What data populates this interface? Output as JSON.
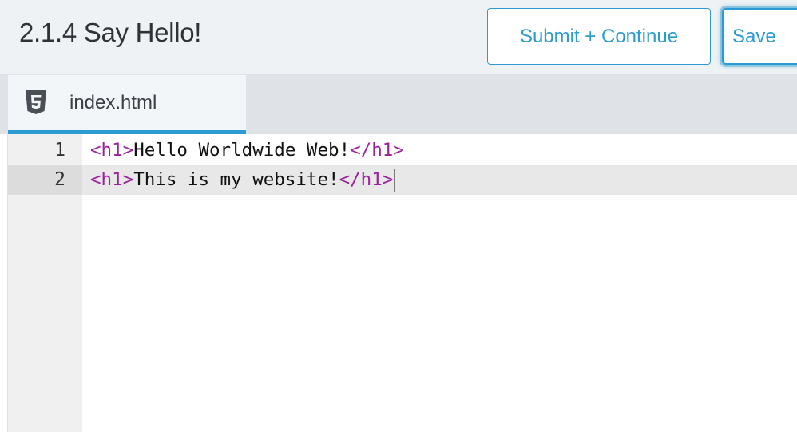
{
  "header": {
    "title": "2.1.4 Say Hello!",
    "submit_label": "Submit + Continue",
    "save_label": "Save"
  },
  "tabs": [
    {
      "label": "index.html",
      "icon": "html5-icon",
      "active": true
    }
  ],
  "editor": {
    "lines": [
      {
        "number": "1",
        "open_tag": "<h1>",
        "text": "Hello Worldwide Web!",
        "close_tag": "</h1>",
        "active": false
      },
      {
        "number": "2",
        "open_tag": "<h1>",
        "text": "This is my website!",
        "close_tag": "</h1>",
        "active": true
      }
    ]
  },
  "colors": {
    "accent": "#2b9bd1",
    "tag": "#9c1f9c",
    "header_bg": "#eff2f5",
    "tabbar_bg": "#dfe3e7"
  }
}
